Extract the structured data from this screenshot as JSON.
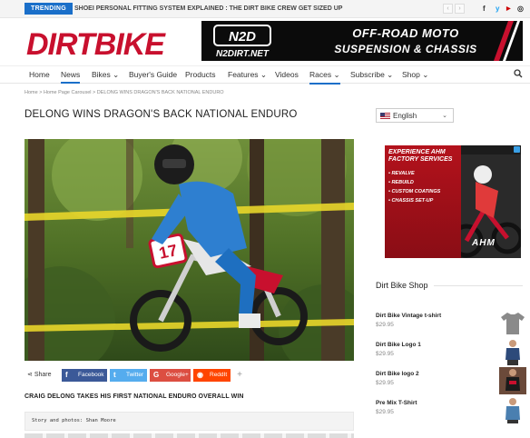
{
  "topbar": {
    "trending_label": "TRENDING",
    "trending_headline": "SHOEI PERSONAL FITTING SYSTEM EXPLAINED : THE DIRT BIKE CREW GET SIZED UP",
    "prev_label": "‹",
    "next_label": "›",
    "social": [
      "f",
      "y",
      "▶",
      "◎"
    ]
  },
  "brand": {
    "logo_text": "DIRTBIKE"
  },
  "top_ad": {
    "brand": "N2D",
    "line1": "OFF-ROAD  MOTO",
    "line2": "SUSPENSION & CHASSIS",
    "url": "N2DIRT.NET"
  },
  "nav": {
    "items": [
      {
        "label": "Home"
      },
      {
        "label": "News"
      },
      {
        "label": "Bikes ⌄"
      },
      {
        "label": "Buyer's Guide"
      },
      {
        "label": "Products"
      },
      {
        "label": "Features ⌄"
      },
      {
        "label": "Videos"
      },
      {
        "label": "Races ⌄"
      },
      {
        "label": "Subscribe ⌄"
      },
      {
        "label": "Shop ⌄"
      }
    ]
  },
  "breadcrumb": "Home  >  Home Page Carousel  >  DELONG WINS DRAGON'S BACK NATIONAL ENDURO",
  "article": {
    "title": "DELONG WINS DRAGON'S BACK NATIONAL ENDURO",
    "subhead": "CRAIG DELONG TAKES HIS FIRST NATIONAL ENDURO OVERALL WIN",
    "byline": "Story and photos: Shan Moore",
    "plate_number": "17"
  },
  "share": {
    "label": "Share",
    "facebook": "Facebook",
    "twitter": "Twitter",
    "google": "Google+",
    "reddit": "ReddIt",
    "more": "+"
  },
  "language": {
    "selected": "English"
  },
  "side_ad": {
    "headline": "EXPERIENCE AHM FACTORY SERVICES",
    "items": [
      "• REVALVE",
      "• REBUILD",
      "• CUSTOM COATINGS",
      "• CHASSIS SET-UP"
    ],
    "brand": "AHM"
  },
  "shop": {
    "title": "Dirt Bike Shop",
    "products": [
      {
        "name": "Dirt Bike Vintage t-shirt",
        "price": "$29.95",
        "color": "#8a8a8a"
      },
      {
        "name": "Dirt Bike Logo 1",
        "price": "$29.95",
        "color": "#2d4a7a"
      },
      {
        "name": "Dirt Bike logo 2",
        "price": "$29.95",
        "color": "#1b1b1b"
      },
      {
        "name": "Pre Mix T-Shirt",
        "price": "$29.95",
        "color": "#4a7fb0"
      }
    ]
  },
  "colors": {
    "accent": "#1a6fc9",
    "logo_red": "#c8102e",
    "facebook": "#3b5998",
    "twitter": "#55acee",
    "google": "#dc4e41",
    "reddit": "#ff4500"
  }
}
